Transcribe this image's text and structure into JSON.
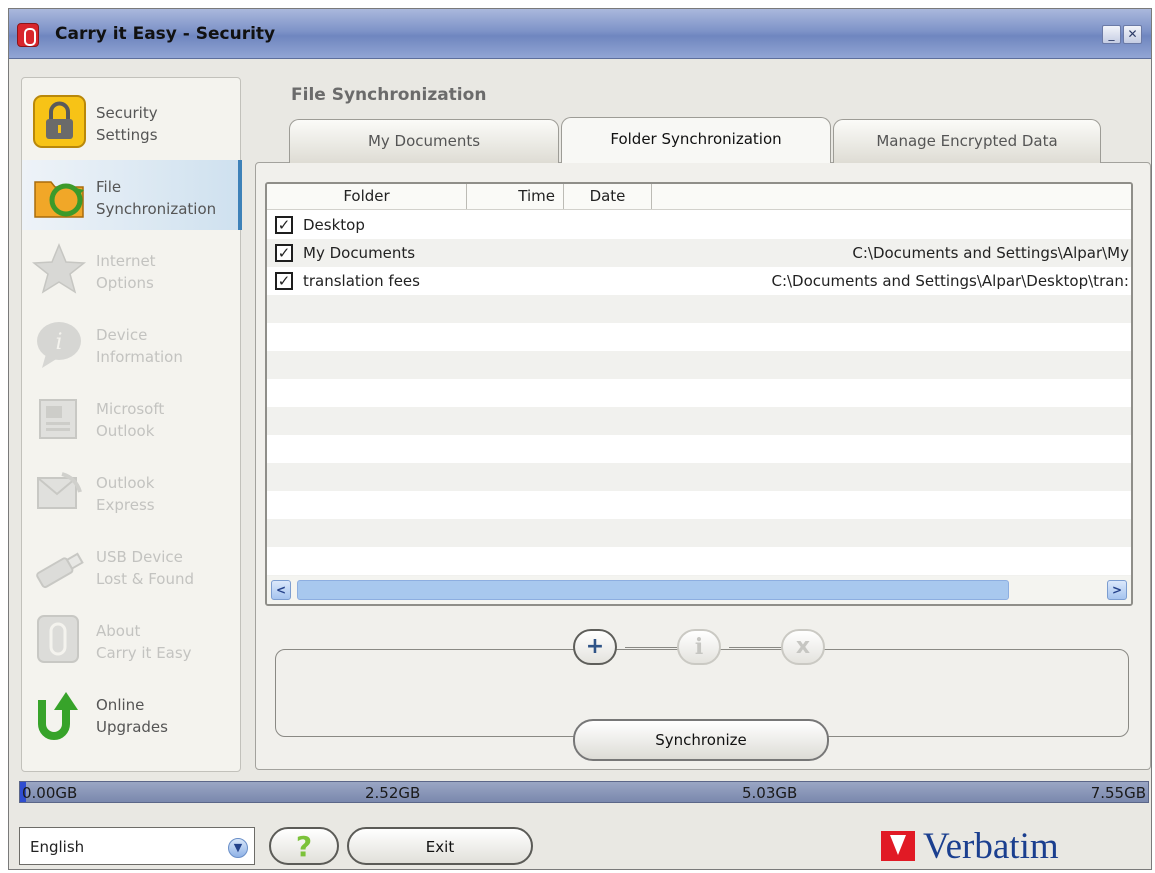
{
  "window": {
    "title": "Carry it Easy - Security",
    "minimize": "_",
    "close": "✕"
  },
  "sidebar": {
    "items": [
      {
        "label": "Security\nSettings",
        "icon": "lock-icon",
        "state": "enabled"
      },
      {
        "label": "File\nSynchronization",
        "icon": "folder-sync-icon",
        "state": "active"
      },
      {
        "label": "Internet\nOptions",
        "icon": "star-icon",
        "state": "disabled"
      },
      {
        "label": "Device\nInformation",
        "icon": "info-bubble-icon",
        "state": "disabled"
      },
      {
        "label": "Microsoft\nOutlook",
        "icon": "outlook-icon",
        "state": "disabled"
      },
      {
        "label": "Outlook\nExpress",
        "icon": "outlook-express-icon",
        "state": "disabled"
      },
      {
        "label": "USB Device\nLost & Found",
        "icon": "usb-drive-icon",
        "state": "disabled"
      },
      {
        "label": "About\nCarry it Easy",
        "icon": "paperclip-icon",
        "state": "disabled"
      },
      {
        "label": "Online\nUpgrades",
        "icon": "upgrade-arrow-icon",
        "state": "enabled"
      }
    ]
  },
  "main": {
    "section_title": "File Synchronization",
    "tabs": [
      {
        "label": "My Documents",
        "active": false
      },
      {
        "label": "Folder Synchronization",
        "active": true
      },
      {
        "label": "Manage Encrypted Data",
        "active": false
      }
    ],
    "list": {
      "columns": [
        "Folder",
        "Time",
        "Date"
      ],
      "rows": [
        {
          "checked": true,
          "name": "Desktop",
          "path": ""
        },
        {
          "checked": true,
          "name": "My Documents",
          "path": "C:\\Documents and Settings\\Alpar\\My"
        },
        {
          "checked": true,
          "name": "translation fees",
          "path": "C:\\Documents and Settings\\Alpar\\Desktop\\tran:"
        }
      ]
    },
    "buttons": {
      "add": "+",
      "info": "i",
      "delete": "x",
      "synchronize": "Synchronize"
    }
  },
  "capacity": {
    "labels": [
      "0.00GB",
      "2.52GB",
      "5.03GB",
      "7.55GB"
    ],
    "used_fraction": 0.005,
    "fill_color": "#2f4dd0"
  },
  "footer": {
    "language": "English",
    "help": "?",
    "exit": "Exit",
    "brand": "Verbatim",
    "brand_color": "#1b3f8f",
    "brand_mark_color": "#e11a25"
  }
}
